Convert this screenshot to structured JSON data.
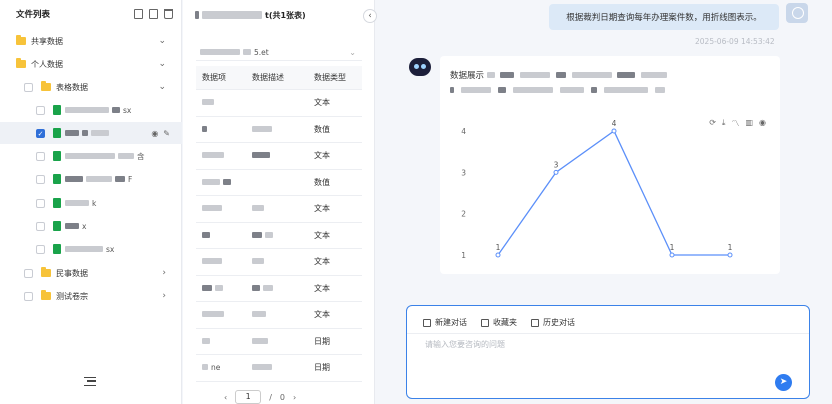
{
  "file_panel": {
    "title": "文件列表",
    "shared_folder": "共享数据",
    "personal_folder": "个人数据",
    "table_folder": "表格数据",
    "files": [
      {
        "suffix": "sx",
        "selected": false
      },
      {
        "suffix": "",
        "selected": true
      },
      {
        "suffix": "含",
        "selected": false
      },
      {
        "suffix": "F",
        "selected": false
      },
      {
        "suffix": "k",
        "selected": false
      },
      {
        "suffix": "x",
        "selected": false
      },
      {
        "suffix": "sx",
        "selected": false
      }
    ],
    "civil_folder": "民事数据",
    "test_folder": "测试卷宗"
  },
  "table_panel": {
    "title_suffix": "t(共1张表)",
    "select_value": "5.et",
    "headers": [
      "数据项",
      "数据描述",
      "数据类型"
    ],
    "types": [
      "文本",
      "数值",
      "文本",
      "数值",
      "文本",
      "文本",
      "文本",
      "文本",
      "文本",
      "日期",
      "日期"
    ],
    "last_row_item": "ne",
    "pager": {
      "current": "1",
      "separator": "/",
      "total": "0"
    }
  },
  "chat": {
    "user_message": "根据裁判日期查询每年办理案件数，用折线图表示。",
    "timestamp": "2025-06-09 14:53:42",
    "answer_prefix": "数据展示"
  },
  "chart_data": {
    "type": "line",
    "x": [
      "",
      "",
      "",
      "",
      ""
    ],
    "values": [
      1,
      3,
      4,
      1,
      1
    ],
    "data_labels": [
      "1",
      "3",
      "4",
      "1",
      "1"
    ],
    "ylim": [
      1,
      4
    ],
    "yticks": [
      "1",
      "2",
      "3",
      "4"
    ],
    "grid": false,
    "color": "#5b8ff9"
  },
  "composer": {
    "new_chat": "新建对话",
    "favorites": "收藏夹",
    "history": "历史对话",
    "placeholder": "请输入您要咨询的问题"
  },
  "colors": {
    "accent": "#2f7cf0",
    "excel_green": "#19a34a",
    "folder_yellow": "#f7c33a",
    "user_bubble": "#dce9f7"
  }
}
